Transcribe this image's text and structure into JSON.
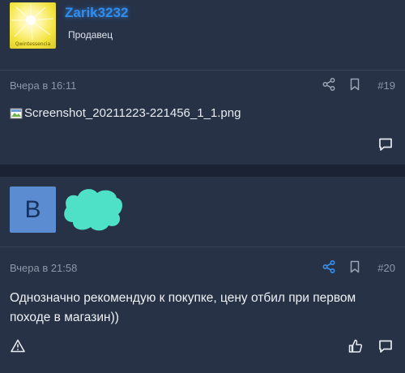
{
  "posts": [
    {
      "username": "Zarik3232",
      "role": "Продавец",
      "avatar_caption": "Qwintessencia",
      "date": "Вчера в 16:11",
      "post_number": "#19",
      "attachment": "Screenshot_20211223-221456_1_1.png",
      "icons": [
        "share-icon",
        "bookmark-icon",
        "comment-icon"
      ]
    },
    {
      "avatar_letter": "B",
      "date": "Вчера в 21:58",
      "post_number": "#20",
      "message": "Однозначно рекомендую к покупке, цену отбил при первом походе в магазин))",
      "icons": [
        "share-icon",
        "bookmark-icon",
        "report-icon",
        "like-icon",
        "comment-icon"
      ]
    }
  ],
  "colors": {
    "background": "#1a2233",
    "card": "#273247",
    "username": "#2f8ef0",
    "meta_text": "#8c97a9",
    "share_active": "#3a8fe8",
    "name_blur_blob": "#4fe0c8",
    "avatar_letter_bg": "#5b8bd0"
  }
}
